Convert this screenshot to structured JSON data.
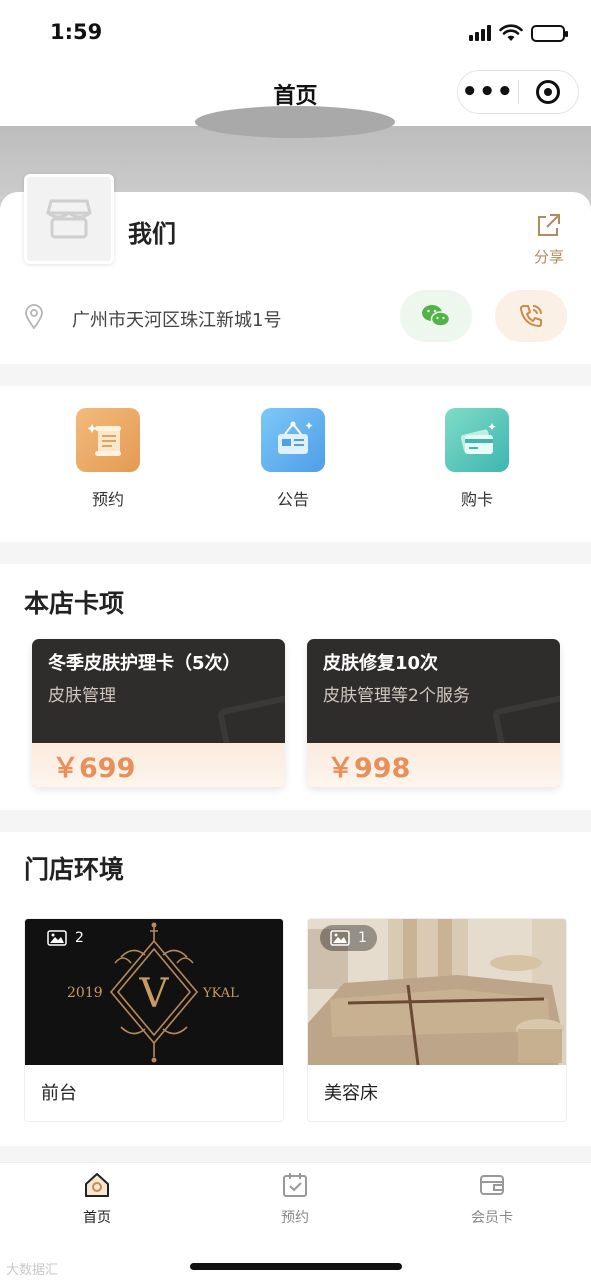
{
  "status_bar": {
    "time": "1:59"
  },
  "nav": {
    "title": "首页"
  },
  "store": {
    "name": "我们",
    "share_label": "分享",
    "address": "广州市天河区珠江新城1号"
  },
  "quick_actions": [
    {
      "label": "预约",
      "icon": "scroll-icon",
      "color": "#e9a866"
    },
    {
      "label": "公告",
      "icon": "notice-board-icon",
      "color": "#5aaff0"
    },
    {
      "label": "购卡",
      "icon": "card-icon",
      "color": "#52c5b4"
    }
  ],
  "cards_section": {
    "title": "本店卡项",
    "cards": [
      {
        "name": "冬季皮肤护理卡（5次）",
        "sub": "皮肤管理",
        "price": "￥699"
      },
      {
        "name": "皮肤修复10次",
        "sub": "皮肤管理等2个服务",
        "price": "￥998"
      }
    ]
  },
  "env_section": {
    "title": "门店环境",
    "items": [
      {
        "label": "前台",
        "count": "2",
        "logo_year": "2019",
        "logo_letter": "V",
        "logo_text": "YKAL"
      },
      {
        "label": "美容床",
        "count": "1"
      }
    ]
  },
  "tabs": [
    {
      "label": "首页",
      "icon": "home-icon",
      "active": true
    },
    {
      "label": "预约",
      "icon": "calendar-check-icon",
      "active": false
    },
    {
      "label": "会员卡",
      "icon": "wallet-icon",
      "active": false
    }
  ],
  "watermark": "大数据汇"
}
